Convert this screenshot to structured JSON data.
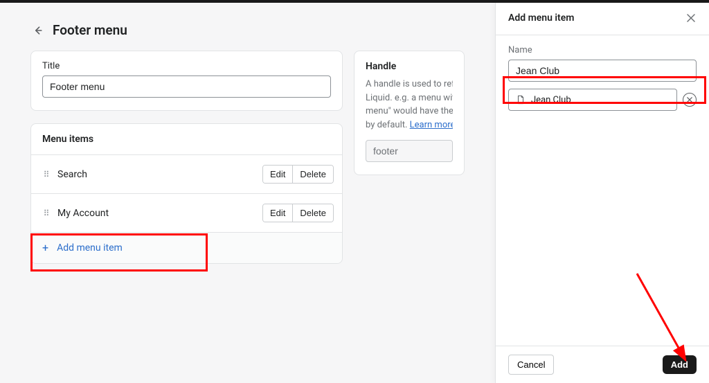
{
  "header": {
    "title": "Footer menu"
  },
  "title_card": {
    "label": "Title",
    "value": "Footer menu"
  },
  "menu_items": {
    "heading": "Menu items",
    "items": [
      {
        "label": "Search",
        "edit": "Edit",
        "delete": "Delete"
      },
      {
        "label": "My Account",
        "edit": "Edit",
        "delete": "Delete"
      }
    ],
    "add_label": "Add menu item"
  },
  "handle": {
    "heading": "Handle",
    "desc_prefix": "A handle is used to reference",
    "desc_line2": "Liquid. e.g. a menu with the t",
    "desc_line3": "menu\" would have the handl",
    "desc_line4_prefix": "by default. ",
    "learn_more": "Learn more",
    "value": "footer"
  },
  "panel": {
    "title": "Add menu item",
    "name_label": "Name",
    "name_value": "Jean Club",
    "link_value": "Jean Club",
    "cancel": "Cancel",
    "add": "Add"
  }
}
